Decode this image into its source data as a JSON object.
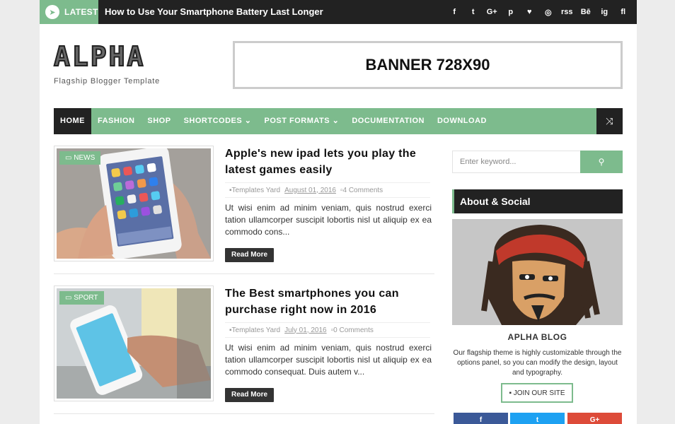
{
  "topbar": {
    "latest_label": "LATEST",
    "rocket_icon": "rocket-icon",
    "ticker": "How to Use Your Smartphone Battery Last Longer",
    "social_glyphs": [
      "f",
      "t",
      "G+",
      "p",
      "♥",
      "◎",
      "rss",
      "Bē",
      "ig",
      "fl"
    ]
  },
  "header": {
    "logo": "ALPHA",
    "tagline": "Flagship Blogger Template",
    "banner": "BANNER 728X90"
  },
  "nav": {
    "items": [
      "HOME",
      "FASHION",
      "SHOP",
      "SHORTCODES ⌄",
      "POST FORMATS ⌄",
      "DOCUMENTATION",
      "DOWNLOAD"
    ],
    "shuffle_glyph": "⤨"
  },
  "posts": [
    {
      "label": "NEWS",
      "title": "Apple's new ipad lets you play the latest games easily",
      "author": "Templates Yard",
      "date": "August 01, 2016",
      "comments": "4 Comments",
      "excerpt": "Ut wisi enim ad minim veniam, quis nostrud exerci tation ullamcorper suscipit lobortis nisl ut aliquip ex ea commodo cons...",
      "read_more": "Read More"
    },
    {
      "label": "SPORT",
      "title": "The Best smartphones you can purchase right now in 2016",
      "author": "Templates Yard",
      "date": "July 01, 2016",
      "comments": "0 Comments",
      "excerpt": "Ut wisi enim ad minim veniam, quis nostrud exerci tation ullamcorper suscipit lobortis nisl ut aliquip ex ea commodo consequat. Duis autem v...",
      "read_more": "Read More"
    }
  ],
  "sidebar": {
    "search_placeholder": "Enter keyword...",
    "widget_title": "About & Social",
    "blog_name": "APLHA BLOG",
    "blog_desc": "Our flagship theme is highly customizable through the options panel, so you can modify the design, layout and typography.",
    "join_label": "JOIN OUR SITE",
    "social_buttons": [
      "f",
      "t",
      "G+"
    ]
  },
  "colors": {
    "accent": "#7dbb8d",
    "dark": "#222222",
    "facebook": "#3b5998",
    "twitter": "#1da1f2",
    "google": "#dd4b39"
  }
}
